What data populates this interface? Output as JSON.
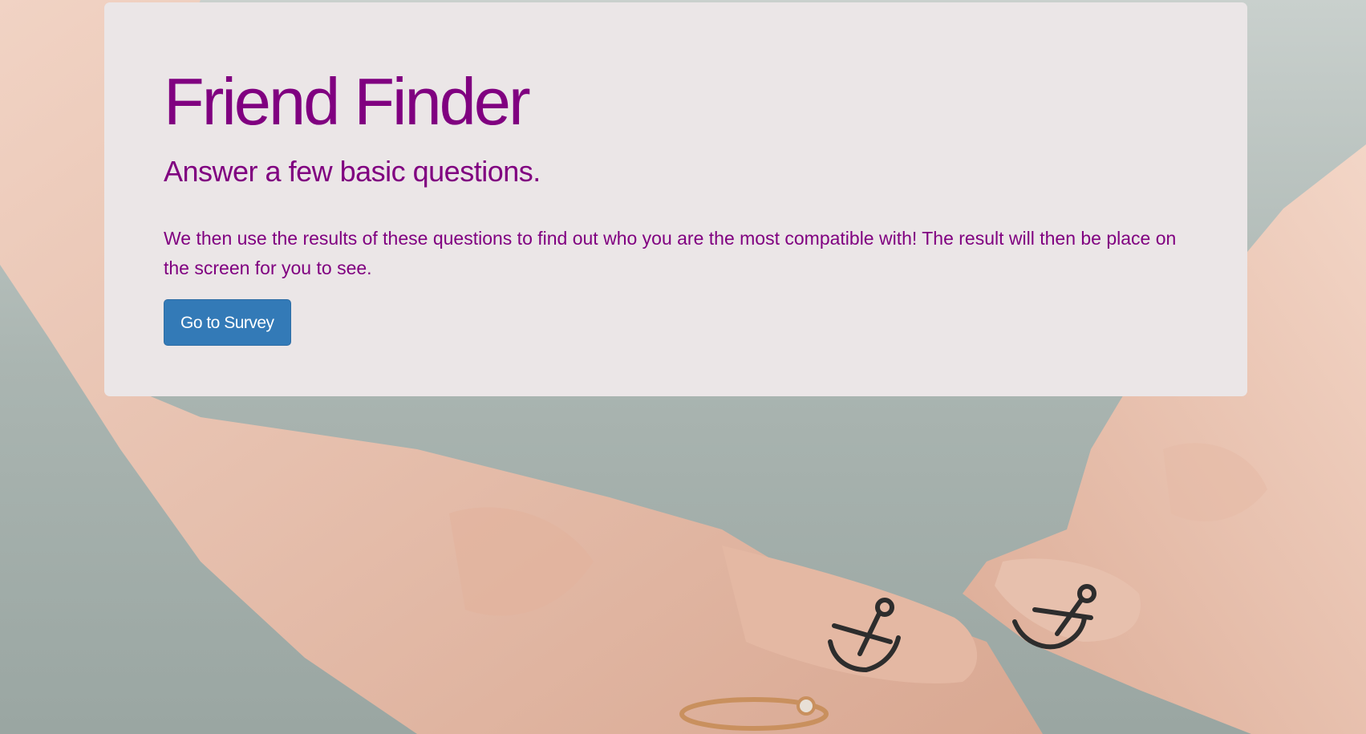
{
  "jumbotron": {
    "title": "Friend Finder",
    "subtitle": "Answer a few basic questions.",
    "description": "We then use the results of these questions to find out who you are the most compatible with! The result will then be place on the screen for you to see.",
    "survey_button_label": "Go to Survey"
  },
  "colors": {
    "accent": "#800080",
    "button": "#337ab7",
    "panel": "#ebe6e7"
  },
  "background": {
    "icon": "hands-with-anchor-tattoos-photo"
  }
}
